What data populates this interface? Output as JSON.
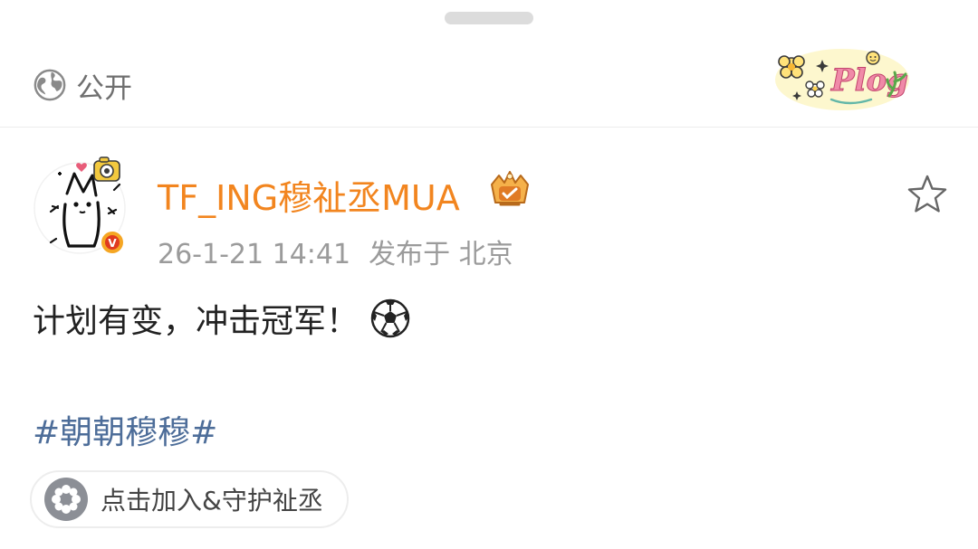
{
  "sheet": {
    "privacy_label": "公开",
    "privacy_icon": "globe-icon"
  },
  "post": {
    "username": "TF_ING穆祉丞MUA",
    "verified_badge": "V",
    "date": "26-1-21 14:41",
    "location": "发布于 北京",
    "text": "计划有变，冲击冠军！",
    "emoji_icon": "soccer-ball-icon",
    "hashtag": "#朝朝穆穆#",
    "join_label": "点击加入&守护祉丞"
  },
  "colors": {
    "username": "#f2851f",
    "hashtag": "#4d6d99",
    "meta": "#9b9b9b",
    "verified": "#f5a623"
  }
}
